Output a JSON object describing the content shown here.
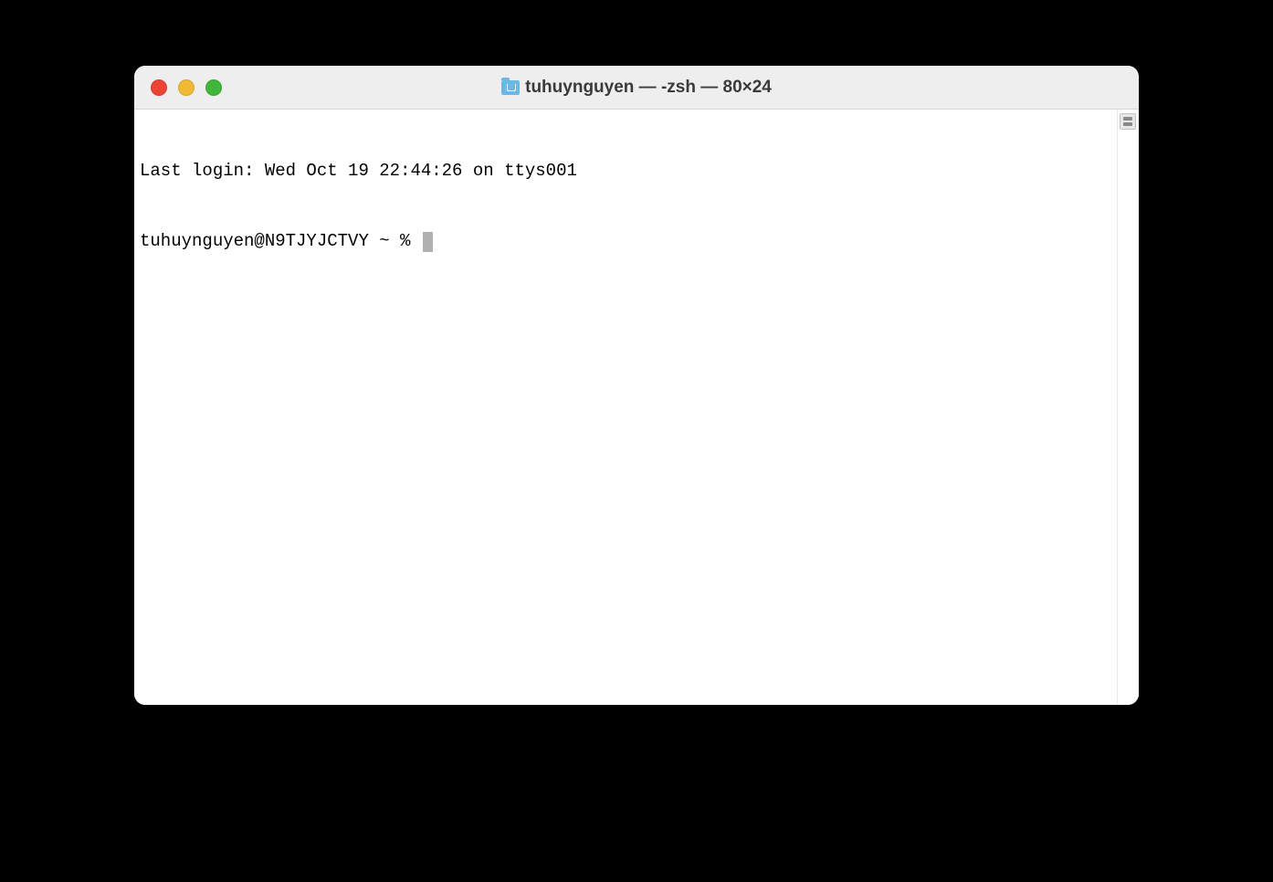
{
  "window": {
    "title": "tuhuynguyen — -zsh — 80×24",
    "icon": "folder-home-icon"
  },
  "terminal": {
    "last_login_line": "Last login: Wed Oct 19 22:44:26 on ttys001",
    "prompt": "tuhuynguyen@N9TJYJCTVY ~ % "
  },
  "traffic_lights": {
    "close": "close",
    "minimize": "minimize",
    "zoom": "zoom"
  }
}
